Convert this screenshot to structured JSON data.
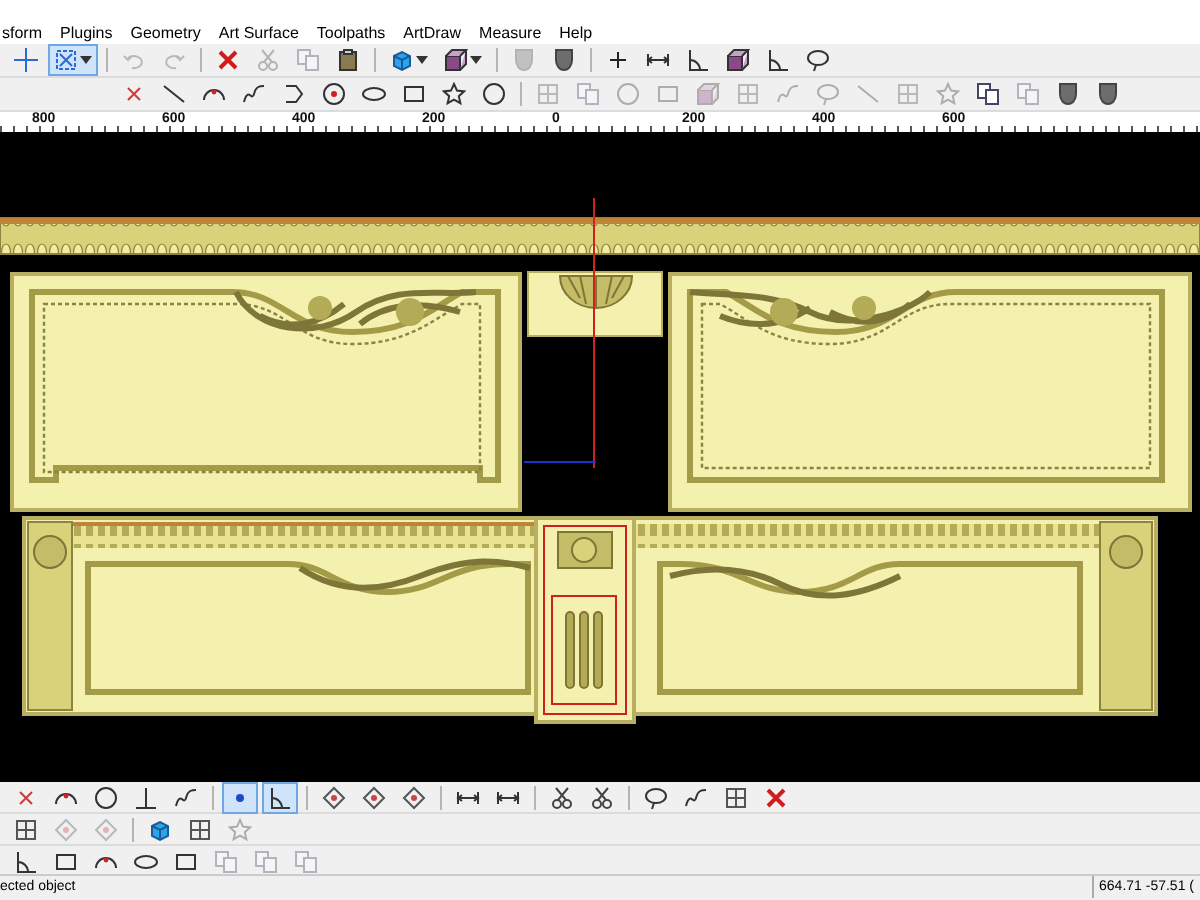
{
  "menu": [
    {
      "label": "sform"
    },
    {
      "label": "Plugins"
    },
    {
      "label": "Geometry"
    },
    {
      "label": "Art Surface"
    },
    {
      "label": "Toolpaths"
    },
    {
      "label": "ArtDraw"
    },
    {
      "label": "Measure"
    },
    {
      "label": "Help"
    }
  ],
  "toolbar_top": [
    {
      "kind": "crosshair",
      "selected": false,
      "disabled": false
    },
    {
      "kind": "select",
      "selected": true,
      "disabled": false,
      "caret": true
    },
    {
      "kind": "separator"
    },
    {
      "kind": "undo",
      "selected": false,
      "disabled": true
    },
    {
      "kind": "redo",
      "selected": false,
      "disabled": true
    },
    {
      "kind": "separator"
    },
    {
      "kind": "delete",
      "selected": false,
      "disabled": false
    },
    {
      "kind": "cut",
      "selected": false,
      "disabled": true
    },
    {
      "kind": "copy",
      "selected": false,
      "disabled": true
    },
    {
      "kind": "paste",
      "selected": false,
      "disabled": false
    },
    {
      "kind": "separator"
    },
    {
      "kind": "cube",
      "selected": false,
      "disabled": false,
      "caret": true
    },
    {
      "kind": "box",
      "selected": false,
      "disabled": false,
      "caret": true
    },
    {
      "kind": "separator"
    },
    {
      "kind": "shield",
      "selected": false,
      "disabled": true
    },
    {
      "kind": "shield",
      "selected": false,
      "disabled": false
    },
    {
      "kind": "separator"
    },
    {
      "kind": "plus",
      "selected": false,
      "disabled": false
    },
    {
      "kind": "dimension",
      "selected": false,
      "disabled": false
    },
    {
      "kind": "angle",
      "selected": false,
      "disabled": false
    },
    {
      "kind": "box",
      "selected": false,
      "disabled": false
    },
    {
      "kind": "angle",
      "selected": false,
      "disabled": false
    },
    {
      "kind": "lasso",
      "selected": false,
      "disabled": false
    }
  ],
  "toolbar_draw": [
    {
      "kind": "cross",
      "selected": false,
      "disabled": false
    },
    {
      "kind": "line",
      "selected": false,
      "disabled": false
    },
    {
      "kind": "arc",
      "selected": false,
      "disabled": false
    },
    {
      "kind": "curve",
      "selected": false,
      "disabled": false
    },
    {
      "kind": "polygon",
      "selected": false,
      "disabled": false
    },
    {
      "kind": "circle-dot",
      "selected": false,
      "disabled": false
    },
    {
      "kind": "ellipse",
      "selected": false,
      "disabled": false
    },
    {
      "kind": "rect",
      "selected": false,
      "disabled": false
    },
    {
      "kind": "star",
      "selected": false,
      "disabled": false
    },
    {
      "kind": "circle",
      "selected": false,
      "disabled": false
    },
    {
      "kind": "separator"
    },
    {
      "kind": "grid",
      "selected": false,
      "disabled": true
    },
    {
      "kind": "copy",
      "selected": false,
      "disabled": true
    },
    {
      "kind": "circle",
      "selected": false,
      "disabled": true
    },
    {
      "kind": "rect",
      "selected": false,
      "disabled": true
    },
    {
      "kind": "box",
      "selected": false,
      "disabled": true
    },
    {
      "kind": "grid",
      "selected": false,
      "disabled": true
    },
    {
      "kind": "curve",
      "selected": false,
      "disabled": true
    },
    {
      "kind": "lasso",
      "selected": false,
      "disabled": true
    },
    {
      "kind": "line",
      "selected": false,
      "disabled": true
    },
    {
      "kind": "grid",
      "selected": false,
      "disabled": true
    },
    {
      "kind": "star",
      "selected": false,
      "disabled": true
    },
    {
      "kind": "copy",
      "selected": false,
      "disabled": false
    },
    {
      "kind": "copy",
      "selected": false,
      "disabled": true
    },
    {
      "kind": "shield",
      "selected": false,
      "disabled": false
    },
    {
      "kind": "shield",
      "selected": false,
      "disabled": false
    }
  ],
  "ruler": {
    "labels": [
      "800",
      "600",
      "400",
      "200",
      "0",
      "200",
      "400",
      "600"
    ]
  },
  "toolbar_bottom_1": [
    {
      "kind": "cross",
      "selected": false,
      "disabled": false
    },
    {
      "kind": "arc",
      "selected": false,
      "disabled": false
    },
    {
      "kind": "circle",
      "selected": false,
      "disabled": false
    },
    {
      "kind": "perpendicular",
      "selected": false,
      "disabled": false
    },
    {
      "kind": "curve",
      "selected": false,
      "disabled": false
    },
    {
      "kind": "separator"
    },
    {
      "kind": "node",
      "selected": true,
      "disabled": false
    },
    {
      "kind": "angle",
      "selected": true,
      "disabled": false
    },
    {
      "kind": "separator"
    },
    {
      "kind": "diamond",
      "selected": false,
      "disabled": false
    },
    {
      "kind": "diamond",
      "selected": false,
      "disabled": false
    },
    {
      "kind": "diamond",
      "selected": false,
      "disabled": false
    },
    {
      "kind": "separator"
    },
    {
      "kind": "dimension",
      "selected": false,
      "disabled": false
    },
    {
      "kind": "dimension",
      "selected": false,
      "disabled": false
    },
    {
      "kind": "separator"
    },
    {
      "kind": "cut",
      "selected": false,
      "disabled": false
    },
    {
      "kind": "cut",
      "selected": false,
      "disabled": false
    },
    {
      "kind": "separator"
    },
    {
      "kind": "lasso",
      "selected": false,
      "disabled": false
    },
    {
      "kind": "curve",
      "selected": false,
      "disabled": false
    },
    {
      "kind": "grid",
      "selected": false,
      "disabled": false
    },
    {
      "kind": "delete",
      "selected": false,
      "disabled": false
    }
  ],
  "toolbar_bottom_2": [
    {
      "kind": "grid",
      "selected": false,
      "disabled": false
    },
    {
      "kind": "diamond",
      "selected": false,
      "disabled": true
    },
    {
      "kind": "diamond",
      "selected": false,
      "disabled": true
    },
    {
      "kind": "separator"
    },
    {
      "kind": "cube",
      "selected": false,
      "disabled": false
    },
    {
      "kind": "grid",
      "selected": false,
      "disabled": false
    },
    {
      "kind": "star",
      "selected": false,
      "disabled": true
    }
  ],
  "toolbar_bottom_3": [
    {
      "kind": "angle",
      "selected": false,
      "disabled": false
    },
    {
      "kind": "rect",
      "selected": false,
      "disabled": false
    },
    {
      "kind": "arc",
      "selected": false,
      "disabled": false
    },
    {
      "kind": "ellipse",
      "selected": false,
      "disabled": false
    },
    {
      "kind": "rect",
      "selected": false,
      "disabled": false
    },
    {
      "kind": "copy",
      "selected": false,
      "disabled": true
    },
    {
      "kind": "copy",
      "selected": false,
      "disabled": true
    },
    {
      "kind": "copy",
      "selected": false,
      "disabled": true
    }
  ],
  "status_bar": {
    "message": "ected object",
    "coordinates": "664.71 -57.51 ("
  }
}
